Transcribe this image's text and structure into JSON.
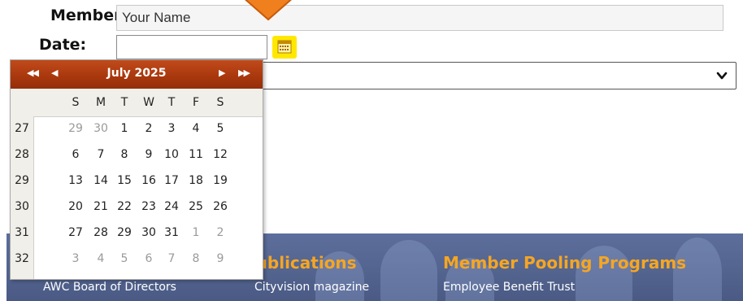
{
  "form": {
    "member_label": "Member:",
    "member_value": "Your Name",
    "date_label": "Date:",
    "date_value": "",
    "select_value": ""
  },
  "calendar": {
    "title": "July 2025",
    "nav": {
      "prev_year": "◀◀",
      "prev_month": "◀",
      "next_month": "▶",
      "next_year": "▶▶"
    },
    "weekday_headers": [
      "S",
      "M",
      "T",
      "W",
      "T",
      "F",
      "S"
    ],
    "weeks": [
      {
        "number": "27",
        "days": [
          "29",
          "30",
          "1",
          "2",
          "3",
          "4",
          "5"
        ],
        "other": [
          true,
          true,
          false,
          false,
          false,
          false,
          false
        ]
      },
      {
        "number": "28",
        "days": [
          "6",
          "7",
          "8",
          "9",
          "10",
          "11",
          "12"
        ],
        "other": [
          false,
          false,
          false,
          false,
          false,
          false,
          false
        ]
      },
      {
        "number": "29",
        "days": [
          "13",
          "14",
          "15",
          "16",
          "17",
          "18",
          "19"
        ],
        "other": [
          false,
          false,
          false,
          false,
          false,
          false,
          false
        ]
      },
      {
        "number": "30",
        "days": [
          "20",
          "21",
          "22",
          "23",
          "24",
          "25",
          "26"
        ],
        "other": [
          false,
          false,
          false,
          false,
          false,
          false,
          false
        ]
      },
      {
        "number": "31",
        "days": [
          "27",
          "28",
          "29",
          "30",
          "31",
          "1",
          "2"
        ],
        "other": [
          false,
          false,
          false,
          false,
          false,
          true,
          true
        ]
      },
      {
        "number": "32",
        "days": [
          "3",
          "4",
          "5",
          "6",
          "7",
          "8",
          "9"
        ],
        "other": [
          true,
          true,
          true,
          true,
          true,
          true,
          true
        ]
      }
    ]
  },
  "footer": {
    "headings": [
      "Publications",
      "Member Pooling Programs"
    ],
    "links": [
      "AWC Board of Directors",
      "Cityvision magazine",
      "Employee Benefit Trust"
    ]
  },
  "colors": {
    "calendar_header": "#a8370d",
    "calendar_button_highlight": "#ffe800",
    "footer_heading": "#f5a623",
    "footer_background": "#55668f",
    "marker_arrow": "#f07f1e"
  },
  "icons": {
    "calendar_button": "calendar-icon",
    "select_chevron": "chevron-down-icon",
    "marker": "arrow-marker-icon"
  }
}
